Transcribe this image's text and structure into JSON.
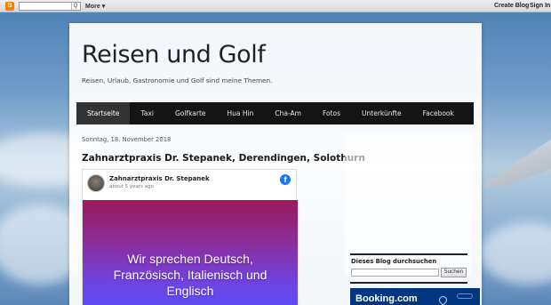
{
  "navbar": {
    "logo_letter": "B",
    "search_button": "Q",
    "more_label": "More",
    "more_arrow": "▾",
    "create_blog_label": "Create Blog",
    "sign_in_label": "Sign In"
  },
  "blog": {
    "title": "Reisen und Golf",
    "description": "Reisen, Urlaub, Gastronomie und Golf sind meine Themen."
  },
  "tabs": [
    {
      "label": "Startseite",
      "active": true
    },
    {
      "label": "Taxi"
    },
    {
      "label": "Golfkarte"
    },
    {
      "label": "Hua Hin"
    },
    {
      "label": "Cha-Am"
    },
    {
      "label": "Fotos"
    },
    {
      "label": "Unterkünfte"
    },
    {
      "label": "Facebook"
    }
  ],
  "post": {
    "date": "Sonntag, 18. November 2018",
    "title": "Zahnarztpraxis Dr. Stepanek, Derendingen, Solothurn",
    "embed": {
      "page_name": "Zahnarztpraxis Dr. Stepanek",
      "time_ago": "about 5 years ago",
      "fb_letter": "f",
      "image_text_line1": "Wir sprechen Deutsch,",
      "image_text_line2": "Französisch, Italienisch und",
      "image_text_line3": "Englisch"
    }
  },
  "sidebar": {
    "search_widget_title": "Dieses Blog durchsuchen",
    "search_button": "Suchen",
    "booking_label": "Booking.com"
  },
  "colors": {
    "tab_bar": "#141414",
    "booking_blue": "#003580",
    "facebook_blue": "#1877f2",
    "blogger_orange": "#f57d00"
  }
}
